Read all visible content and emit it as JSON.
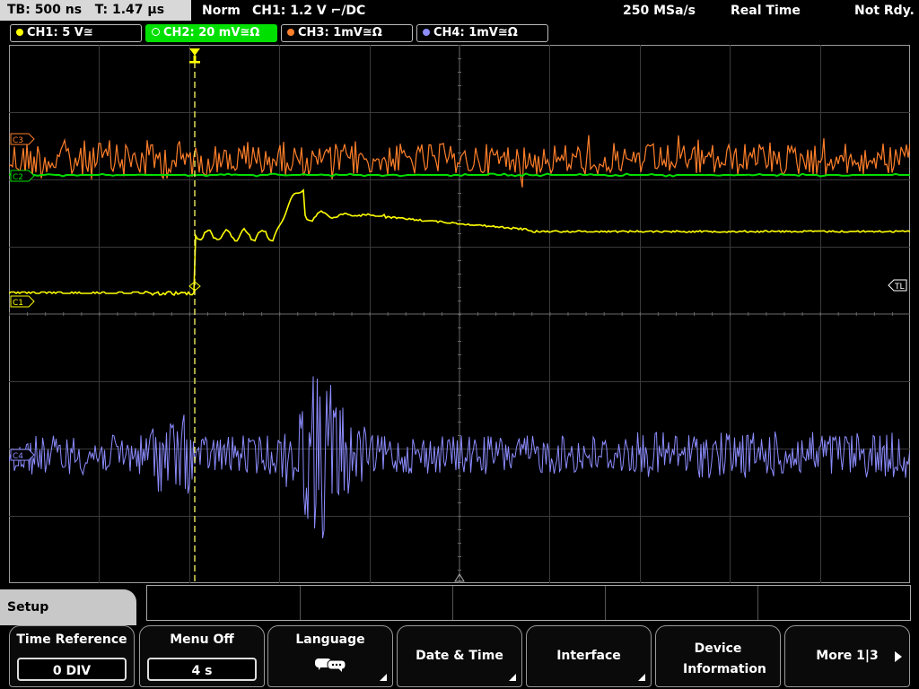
{
  "status": {
    "timebase": "TB: 500 ns",
    "trigger_time": "T: 1.47 µs",
    "mode": "Norm",
    "trigger_setting": "CH1: 1.2 V ⌐/DC",
    "sample_rate": "250 MSa/s",
    "acq_mode": "Real Time",
    "state": "Not Rdy."
  },
  "channels": [
    {
      "label": "CH1: 5 V≅",
      "color": "#ffff00",
      "active": false
    },
    {
      "label": "CH2: 20 mV≅Ω",
      "color": "#00e000",
      "active": true
    },
    {
      "label": "CH3: 1mV≅Ω",
      "color": "#ff7f2a",
      "active": false
    },
    {
      "label": "CH4: 1mV≅Ω",
      "color": "#8c8cff",
      "active": false
    }
  ],
  "markers": {
    "c1": "C1",
    "c2": "C2",
    "c3": "C3",
    "c4": "C4",
    "trigger_level": "TL",
    "trigger_point": "T"
  },
  "menu": {
    "title": "Setup",
    "keys": [
      {
        "label": "Time Reference",
        "value": "0 DIV"
      },
      {
        "label": "Menu Off",
        "value": "4 s"
      },
      {
        "label": "Language",
        "icon": "speech-bubbles-icon"
      },
      {
        "label": "Date & Time"
      },
      {
        "label": "Interface"
      },
      {
        "label": "Device Information"
      },
      {
        "label": "More 1|3"
      }
    ]
  }
}
